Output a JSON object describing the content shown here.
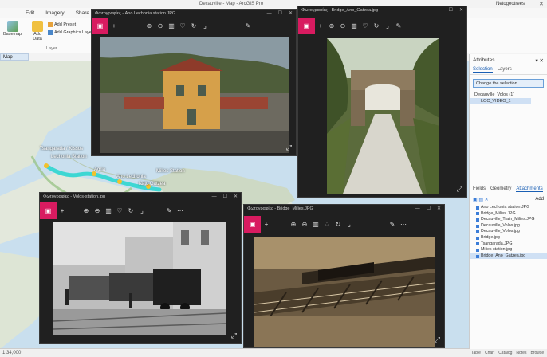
{
  "app": {
    "title": "Decauville - Map - ArcGIS Pro",
    "ribbon_tabs": [
      "Edit",
      "Imagery",
      "Share"
    ],
    "ribbon_tools": {
      "basemap": "Basemap",
      "add_data": "Add Data",
      "add_preset": "Add Preset",
      "add_graphics_layer": "Add Graphics Layer",
      "group_label": "Layer"
    },
    "user": "Netogeotrees",
    "map_tab": "Map"
  },
  "map": {
    "labels": [
      {
        "text": "Tsangarada / Kissos",
        "color": "#ffffff"
      },
      {
        "text": "Lechonia Station",
        "color": "#ffffff"
      },
      {
        "text": "Ano Lechonia",
        "color": "#ffffff"
      },
      {
        "text": "Kato Gatzea",
        "color": "#ffffff"
      },
      {
        "text": "Milies Station",
        "color": "#ffffff"
      },
      {
        "text": "Agria",
        "color": "#ffffff"
      }
    ],
    "route_color": "#3dd7d3",
    "status": "1:34,000"
  },
  "attributes_panel": {
    "title": "Attributes",
    "tabs": [
      "Selection",
      "Layers"
    ],
    "dropdown": "Change the selection",
    "tree": [
      "Decauville_Volos (1)",
      "LOC_VIDEO_1"
    ]
  },
  "catalog_panel": {
    "tabs": [
      "Fields",
      "Geometry",
      "Attachments"
    ],
    "add_label": "Add",
    "files": [
      "Ano Lechonia station.JPG",
      "Bridge_Milies.JPG",
      "Decauville_Train_Milies.JPG",
      "Decauville_Volos.jpg",
      "Decauville_Volos.jpg",
      "Bridge.jpg",
      "Tsangarada.JPG",
      "Milies station.jpg",
      "Bridge_Ano_Gatzea.jpg"
    ],
    "selected_index": 8
  },
  "right_status": [
    "Table",
    "Chart",
    "Catalog",
    "Notes",
    "Browse"
  ],
  "photo_windows": [
    {
      "title": "Φωτογραφίες - Ano Lechonia station.JPG"
    },
    {
      "title": "Φωτογραφίες - Bridge_Ano_Gatzea.jpg"
    },
    {
      "title": "Φωτογραφίες - Volos-station.jpg"
    },
    {
      "title": "Φωτογραφίες - Bridge_Milies.JPG"
    }
  ]
}
